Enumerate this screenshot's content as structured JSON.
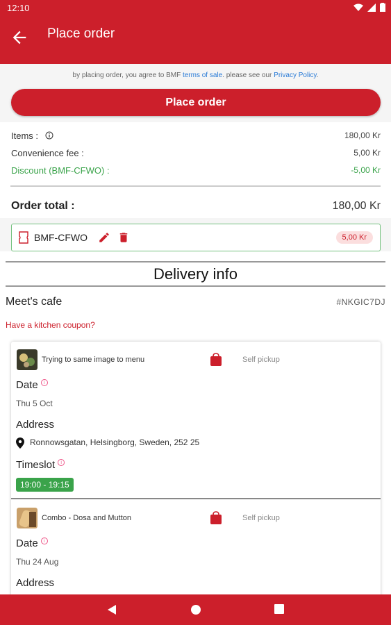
{
  "status_bar": {
    "time": "12:10"
  },
  "app_bar": {
    "title": "Place order"
  },
  "agreement": {
    "prefix": "by placing order, you agree to BMF ",
    "terms": "terms of sale",
    "middle": ". please see our ",
    "privacy": "Privacy Policy",
    "suffix": "."
  },
  "place_order_label": "Place order",
  "summary": {
    "items_label": "Items :",
    "items_value": "180,00 Kr",
    "fee_label": "Convenience fee :",
    "fee_value": "5,00 Kr",
    "discount_label": "Discount (BMF-CFWO) :",
    "discount_value": "-5,00 Kr",
    "total_label": "Order total :",
    "total_value": "180,00 Kr"
  },
  "coupon": {
    "code": "BMF-CFWO",
    "amount": "5,00 Kr"
  },
  "delivery": {
    "title": "Delivery info",
    "cafe_name": "Meet's cafe",
    "cafe_code": "#NKGIC7DJ",
    "kitchen_coupon": "Have a kitchen coupon?",
    "items": [
      {
        "name": "Trying to same image to menu",
        "pickup": "Self pickup",
        "date_label": "Date",
        "date": "Thu 5 Oct",
        "address_label": "Address",
        "address": "Ronnowsgatan, Helsingborg, Sweden, 252 25",
        "timeslot_label": "Timeslot",
        "timeslot": "19:00 - 19:15"
      },
      {
        "name": "Combo - Dosa and Mutton",
        "pickup": "Self pickup",
        "date_label": "Date",
        "date": "Thu 24 Aug",
        "address_label": "Address"
      }
    ]
  },
  "colors": {
    "primary": "#cc1f2b",
    "green": "#3aa34a",
    "link": "#2a7bd6"
  },
  "icons": [
    "back-arrow-icon",
    "info-icon",
    "ticket-icon",
    "edit-icon",
    "trash-icon",
    "bag-icon",
    "location-pin-icon",
    "nav-back-icon",
    "nav-home-icon",
    "nav-recents-icon"
  ]
}
